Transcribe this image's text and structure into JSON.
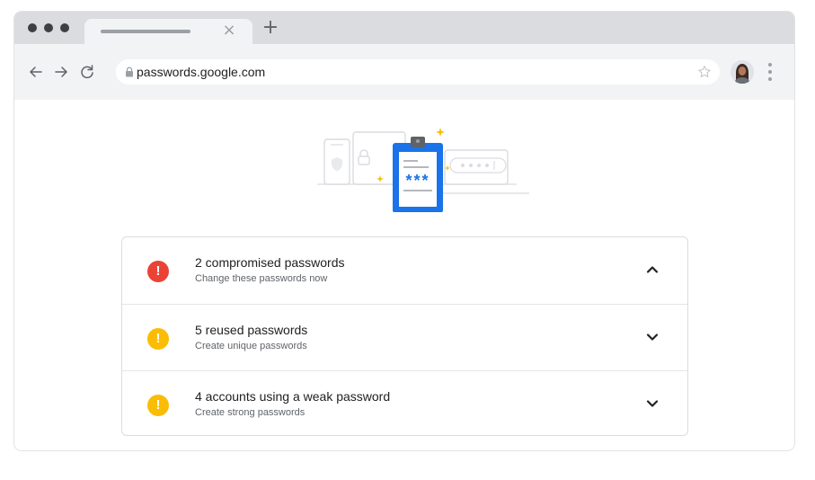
{
  "browser": {
    "new_tab_symbol": "+",
    "tab_close_symbol": "×",
    "url": "passwords.google.com",
    "icons": [
      "back-icon",
      "forward-icon",
      "reload-icon",
      "lock-icon",
      "star-icon",
      "menu-icon"
    ]
  },
  "illustration": {
    "masked_value": "***"
  },
  "checkup": {
    "items": [
      {
        "title": "2 compromised passwords",
        "subtitle": "Change these passwords now",
        "alert": "!",
        "color": "#ea4335",
        "expanded": true
      },
      {
        "title": "5 reused passwords",
        "subtitle": "Create unique passwords",
        "alert": "!",
        "color": "#fbbc04",
        "expanded": false
      },
      {
        "title": "4 accounts using a weak password",
        "subtitle": "Create strong passwords",
        "alert": "!",
        "color": "#fbbc04",
        "expanded": false
      }
    ]
  }
}
